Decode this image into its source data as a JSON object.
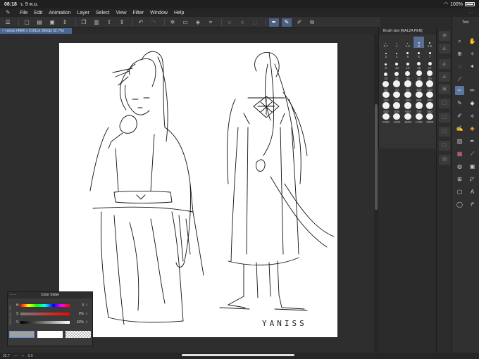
{
  "status": {
    "time": "08:18",
    "date": "ว. 9 พ.ย.",
    "battery": "100%"
  },
  "menu": [
    "File",
    "Edit",
    "Animation",
    "Layer",
    "Select",
    "View",
    "Filter",
    "Window",
    "Help"
  ],
  "toolbar_icons": [
    "menu-icon",
    "new-icon",
    "open-icon",
    "save-icon",
    "copy-icon",
    "paste-icon",
    "export-icon",
    "undo-icon",
    "redo-icon",
    "gear-icon",
    "move-icon",
    "fill-icon",
    "transform-icon",
    "brush-icon",
    "pen-icon",
    "hand-icon",
    "eye-icon"
  ],
  "document_tab": "× yaniss (4866 x 5181px 350dpi 32.7%)",
  "canvas": {
    "signature_text": "YANISS"
  },
  "bottom_bar": {
    "zoom": "32.7",
    "angle": "0.0"
  },
  "color_slider": {
    "title": "Color Slider",
    "side_tabs": "RGB HSV CMY",
    "h": {
      "label": "H",
      "value": "0"
    },
    "s": {
      "label": "S",
      "value": "0%"
    },
    "v": {
      "label": "V",
      "value": "63%"
    },
    "colors": {
      "main": "#a0a0a0",
      "sub": "#ffffff"
    }
  },
  "brush_size": {
    "title": "Brush size [MALZA PEN]",
    "sizes": [
      "0.7",
      "1",
      "1.5",
      "2",
      "2.5",
      "3",
      "4",
      "5",
      "6",
      "7",
      "8",
      "10",
      "12",
      "15",
      "17",
      "20",
      "25",
      "30",
      "40",
      "50",
      "60",
      "70",
      "80",
      "100",
      "120",
      "150",
      "170",
      "200",
      "250",
      "300",
      "400",
      "500",
      "600",
      "700",
      "800",
      "1000",
      "1200",
      "1500",
      "1700",
      "2000"
    ],
    "selected": "2"
  },
  "tool_panel": {
    "title": "Tool"
  }
}
